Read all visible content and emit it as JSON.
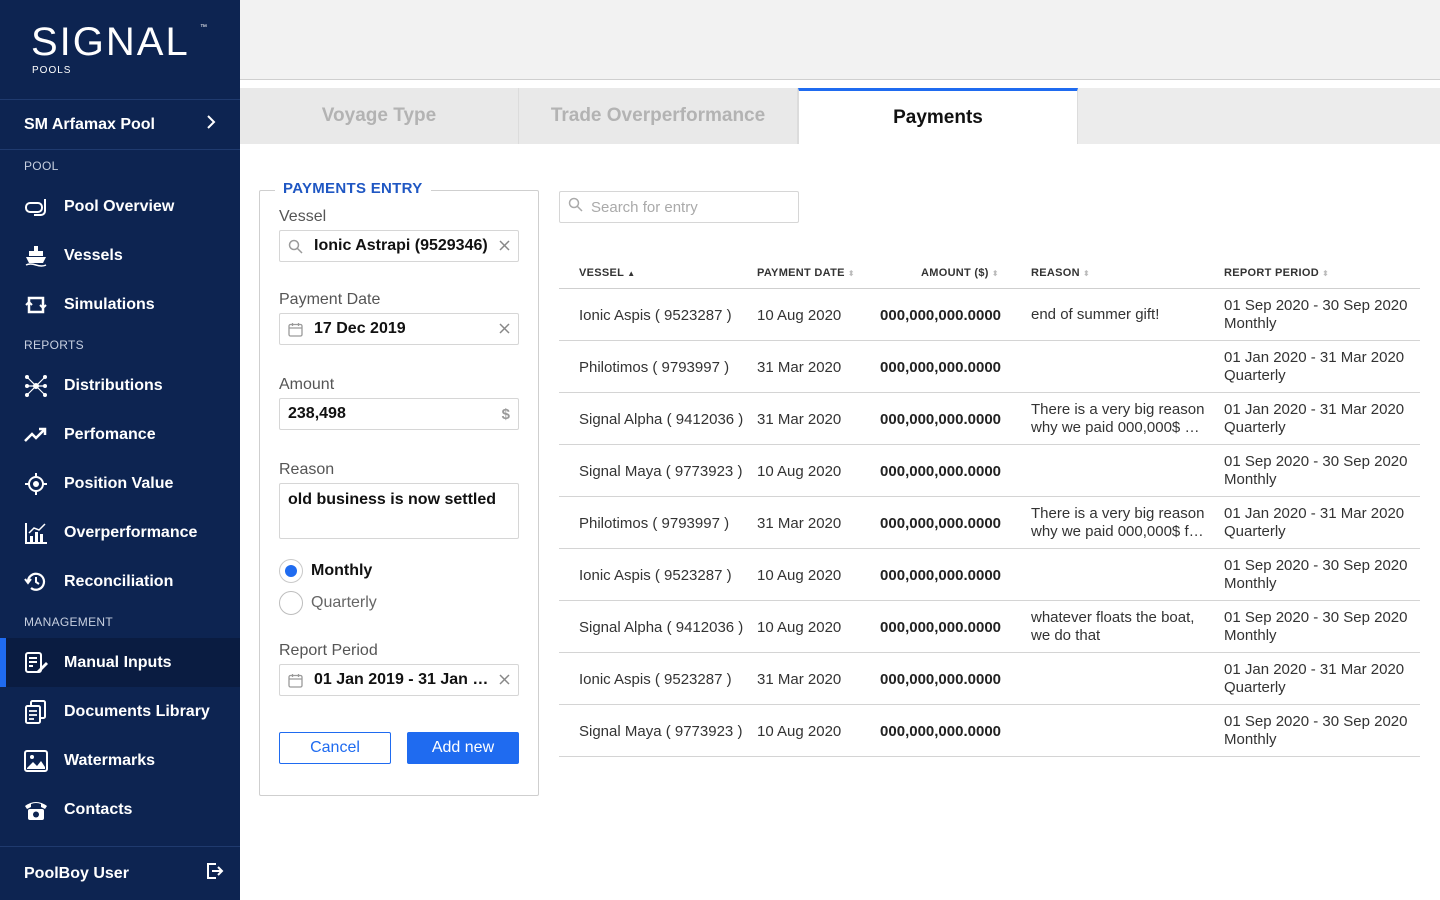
{
  "brand": {
    "name": "SIGNAL",
    "tm": "™",
    "sub": "POOLS"
  },
  "pool_selector": {
    "label": "SM Arfamax Pool",
    "chevron": "chevron-right-icon"
  },
  "sidebar": {
    "sections": [
      {
        "label": "POOL",
        "items": [
          {
            "label": "Pool Overview",
            "icon": "snorkel-icon"
          },
          {
            "label": "Vessels",
            "icon": "ship-icon"
          },
          {
            "label": "Simulations",
            "icon": "refresh-icon"
          }
        ]
      },
      {
        "label": "REPORTS",
        "items": [
          {
            "label": "Distributions",
            "icon": "network-icon"
          },
          {
            "label": "Perfomance",
            "icon": "trend-up-icon"
          },
          {
            "label": "Position Value",
            "icon": "crosshair-icon"
          },
          {
            "label": "Overperformance",
            "icon": "bar-chart-icon"
          },
          {
            "label": "Reconciliation",
            "icon": "history-icon"
          }
        ]
      },
      {
        "label": "MANAGEMENT",
        "items": [
          {
            "label": "Manual Inputs",
            "icon": "edit-document-icon",
            "active": true
          },
          {
            "label": "Documents Library",
            "icon": "documents-icon"
          },
          {
            "label": "Watermarks",
            "icon": "image-icon"
          },
          {
            "label": "Contacts",
            "icon": "phone-icon"
          }
        ]
      }
    ],
    "user": {
      "label": "PoolBoy User",
      "icon": "logout-icon"
    }
  },
  "tabs": [
    {
      "label": "Voyage Type",
      "active": false
    },
    {
      "label": "Trade Overperformance",
      "active": false
    },
    {
      "label": "Payments",
      "active": true
    }
  ],
  "form": {
    "legend": "PAYMENTS ENTRY",
    "vessel": {
      "label": "Vessel",
      "value": "Ionic Astrapi (9529346)"
    },
    "payment_date": {
      "label": "Payment Date",
      "value": "17 Dec 2019"
    },
    "amount": {
      "label": "Amount",
      "value": "238,498",
      "unit": "$"
    },
    "reason": {
      "label": "Reason",
      "value": "old business is now settled"
    },
    "frequency": {
      "options": [
        "Monthly",
        "Quarterly"
      ],
      "selected": "Monthly"
    },
    "report_period": {
      "label": "Report Period",
      "value": "01 Jan 2019 - 31 Jan 20..."
    },
    "cancel_label": "Cancel",
    "add_label": "Add new"
  },
  "search": {
    "placeholder": "Search for entry"
  },
  "table": {
    "columns": [
      "VESSEL",
      "PAYMENT DATE",
      "AMOUNT ($)",
      "REASON",
      "REPORT PERIOD"
    ],
    "sorted_column": "VESSEL",
    "rows": [
      {
        "vessel": "Ionic Aspis ( 9523287 )",
        "date": "10 Aug 2020",
        "amount": "000,000,000.0000",
        "reason": "end of summer gift!",
        "period": "01 Sep 2020 - 30 Sep 2020",
        "frequency": "Monthly"
      },
      {
        "vessel": "Philotimos ( 9793997 )",
        "date": "31 Mar 2020",
        "amount": "000,000,000.0000",
        "reason": "",
        "period": "01 Jan 2020 - 31 Mar 2020",
        "frequency": "Quarterly"
      },
      {
        "vessel": "Signal Alpha ( 9412036 )",
        "date": "31 Mar 2020",
        "amount": "000,000,000.0000",
        "reason": "There is a very big reason why we paid 000,000$ …",
        "period": "01 Jan 2020 - 31 Mar 2020",
        "frequency": "Quarterly"
      },
      {
        "vessel": "Signal Maya ( 9773923 )",
        "date": "10 Aug 2020",
        "amount": "000,000,000.0000",
        "reason": "",
        "period": "01 Sep 2020 - 30 Sep 2020",
        "frequency": "Monthly"
      },
      {
        "vessel": "Philotimos ( 9793997 )",
        "date": "31 Mar 2020",
        "amount": "000,000,000.0000",
        "reason": "There is a very big reason why we paid 000,000$ f…",
        "period": "01 Jan 2020 - 31 Mar 2020",
        "frequency": "Quarterly"
      },
      {
        "vessel": "Ionic Aspis ( 9523287 )",
        "date": "10 Aug 2020",
        "amount": "000,000,000.0000",
        "reason": "",
        "period": "01 Sep 2020 - 30 Sep 2020",
        "frequency": "Monthly"
      },
      {
        "vessel": "Signal Alpha ( 9412036 )",
        "date": "10 Aug 2020",
        "amount": "000,000,000.0000",
        "reason": "whatever floats the boat, we do that",
        "period": "01 Sep 2020 - 30 Sep 2020",
        "frequency": "Monthly"
      },
      {
        "vessel": "Ionic Aspis ( 9523287 )",
        "date": "31 Mar 2020",
        "amount": "000,000,000.0000",
        "reason": "",
        "period": "01 Jan 2020 - 31 Mar 2020",
        "frequency": "Quarterly"
      },
      {
        "vessel": "Signal Maya ( 9773923 )",
        "date": "10 Aug 2020",
        "amount": "000,000,000.0000",
        "reason": "",
        "period": "01 Sep 2020 - 30 Sep 2020",
        "frequency": "Monthly"
      }
    ]
  },
  "colors": {
    "sidebar": "#0d2451",
    "accent": "#1f6bf0",
    "legend": "#1f57c3"
  }
}
